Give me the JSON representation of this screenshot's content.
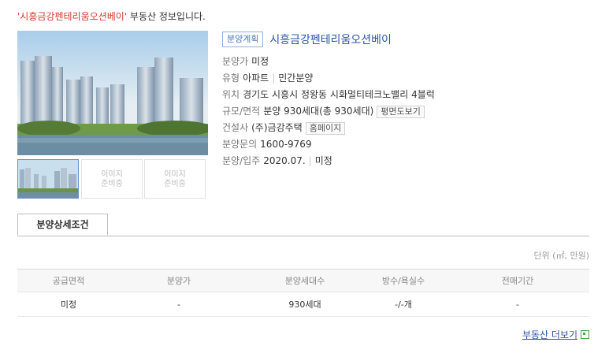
{
  "header": {
    "quoted_name": "'시흥금강펜테리움오션베이'",
    "suffix": "부동산 정보입니다."
  },
  "gallery": {
    "main_alt": "apartment-rendering",
    "placeholder_1": "이미지\n준비중",
    "placeholder_2": "이미지\n준비중"
  },
  "info": {
    "badge": "분양계획",
    "title": "시흥금강펜테리움오션베이",
    "price_label": "분양가",
    "price_value": "미정",
    "type_label": "유형",
    "type_value_1": "아파트",
    "type_value_2": "민간분양",
    "location_label": "위치",
    "location_value": "경기도 시흥시 정왕동 시화멀티테크노밸리 4블럭",
    "size_label": "규모/면적",
    "size_value": "분양 930세대(총 930세대)",
    "floorplan_button": "평면도보기",
    "builder_label": "건설사",
    "builder_value": "(주)금강주택",
    "homepage_button": "홈페이지",
    "inquiry_label": "분양문의",
    "inquiry_value": "1600-9769",
    "schedule_label": "분양/입주",
    "schedule_value_1": "2020.07.",
    "schedule_value_2": "미정"
  },
  "tabs": [
    {
      "label": "분양상세조건"
    }
  ],
  "unit_note": "단위 (㎡, 만원)",
  "table": {
    "headers": [
      "공급면적",
      "분양가",
      "분양세대수",
      "방수/욕실수",
      "전매기간"
    ],
    "rows": [
      [
        "미정",
        "-",
        "930세대",
        "-/-개",
        "-"
      ]
    ]
  },
  "more_link": "부동산 더보기"
}
